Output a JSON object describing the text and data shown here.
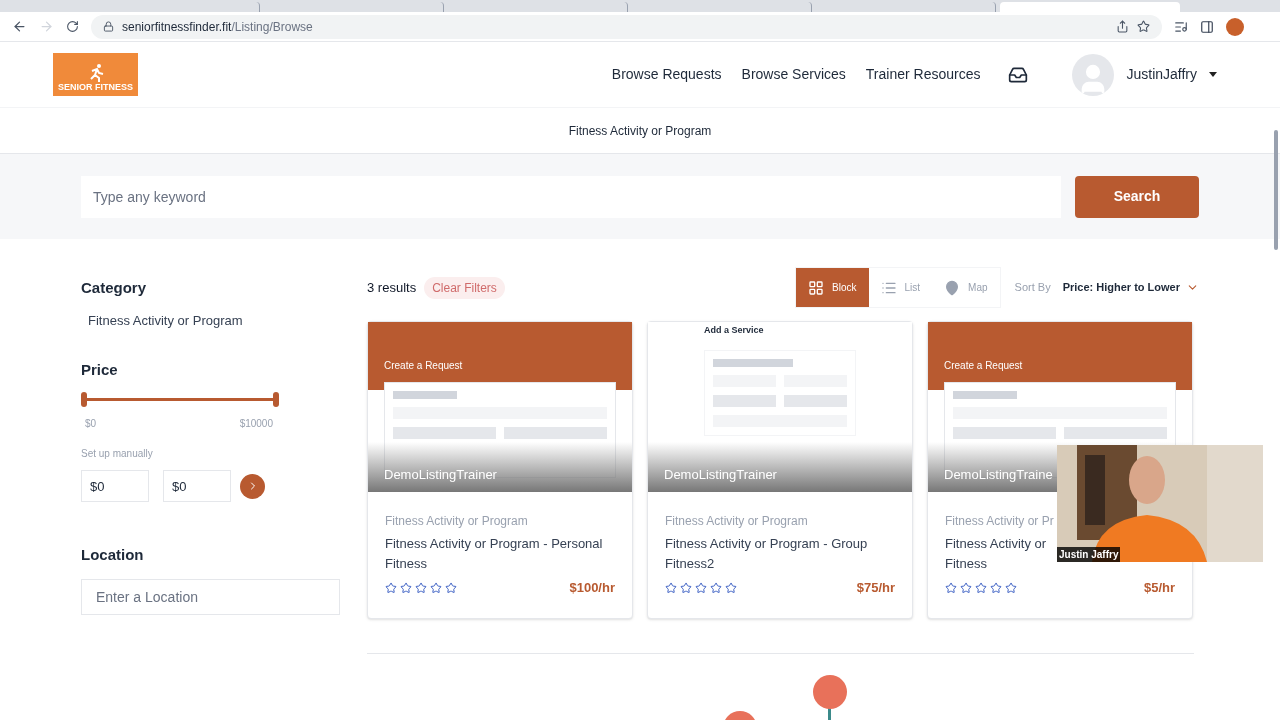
{
  "browser": {
    "tabs": [
      {
        "selected": false
      },
      {
        "selected": false
      },
      {
        "selected": false
      },
      {
        "selected": false
      },
      {
        "selected": false
      },
      {
        "selected": true
      }
    ],
    "url_host": "seniorfitnessfinder.fit",
    "url_path": "/Listing/Browse"
  },
  "header": {
    "logo_text": "SENIOR FITNESS",
    "nav": [
      "Browse Requests",
      "Browse Services",
      "Trainer Resources"
    ],
    "user": "JustinJaffry"
  },
  "subtitle": "Fitness Activity or Program",
  "search": {
    "placeholder": "Type any keyword",
    "button": "Search"
  },
  "filters": {
    "category_title": "Category",
    "category": "Fitness Activity or Program",
    "price_title": "Price",
    "price": {
      "level": 1,
      "min_label": "$0",
      "max_label": "$10000"
    },
    "manual_label": "Set up manually",
    "min_value": "$0",
    "max_value": "$0",
    "location_title": "Location",
    "location_placeholder": "Enter a Location"
  },
  "results": {
    "count": "3 results",
    "clear": "Clear Filters",
    "views": [
      {
        "kind": "block",
        "label": "Block",
        "selected": true
      },
      {
        "kind": "list",
        "label": "List",
        "selected": false
      },
      {
        "kind": "map",
        "label": "Map",
        "selected": false
      }
    ],
    "sort_label": "Sort By",
    "sort_value": "Price: Higher to Lower"
  },
  "cards": [
    {
      "kind": "request",
      "thumb_title": "Create a Request",
      "trainer": "DemoListingTrainer",
      "category": "Fitness Activity or Program",
      "title_lines": [
        "Fitness Activity or Program - Personal",
        "Fitness"
      ],
      "stars": 0,
      "price": "$100/hr"
    },
    {
      "kind": "service",
      "thumb_title": "Add a Service",
      "trainer": "DemoListingTrainer",
      "category": "Fitness Activity or Program",
      "title_lines": [
        "Fitness Activity or Program - Group",
        "Fitness2"
      ],
      "stars": 0,
      "price": "$75/hr"
    },
    {
      "kind": "request",
      "thumb_title": "Create a Request",
      "trainer": "DemoListingTraine",
      "category": "Fitness Activity or Pr",
      "title_lines": [
        "Fitness Activity or",
        "Fitness"
      ],
      "stars": 0,
      "price": "$5/hr"
    }
  ],
  "video": {
    "caption": "Justin Jaffry"
  }
}
